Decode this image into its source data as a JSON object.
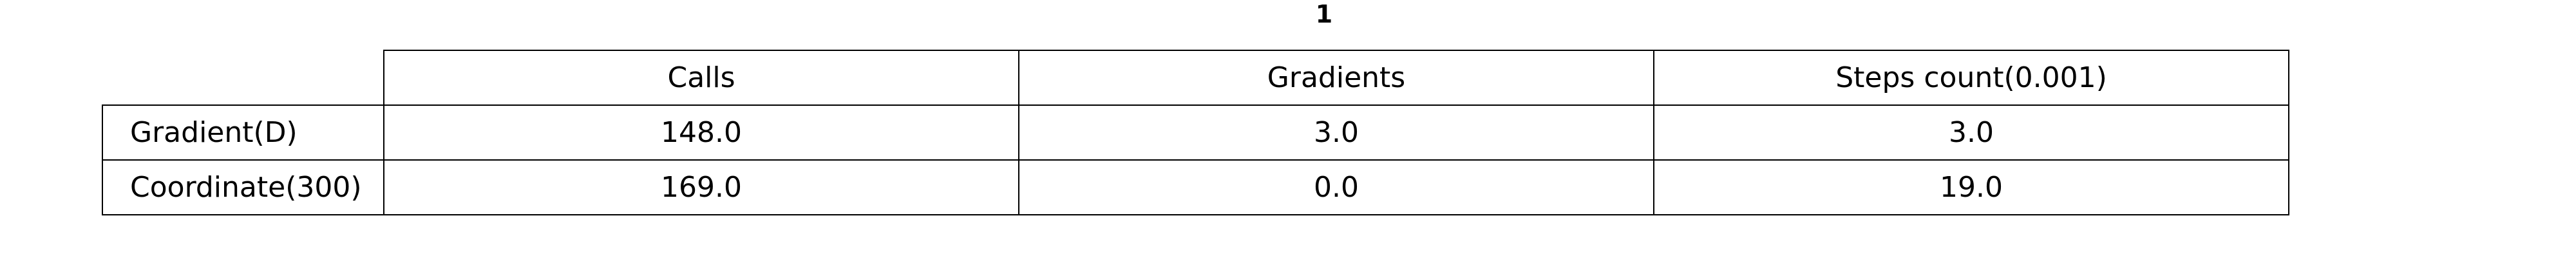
{
  "chart_data": {
    "type": "table",
    "title": "1",
    "columns": [
      "Calls",
      "Gradients",
      "Steps count(0.001)"
    ],
    "rows": [
      {
        "label": "Gradient(D)",
        "values": [
          "148.0",
          "3.0",
          "3.0"
        ]
      },
      {
        "label": "Coordinate(300)",
        "values": [
          "169.0",
          "0.0",
          "19.0"
        ]
      }
    ]
  }
}
